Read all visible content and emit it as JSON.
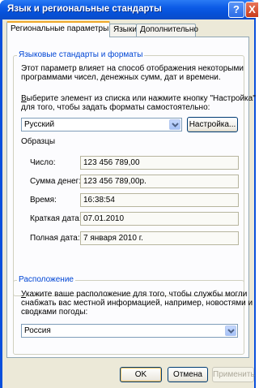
{
  "window": {
    "title": "Язык и региональные стандарты",
    "help_glyph": "?",
    "close_glyph": "X"
  },
  "tabs": [
    {
      "label": "Региональные параметры",
      "active": true
    },
    {
      "label": "Языки",
      "active": false
    },
    {
      "label": "Дополнительно",
      "active": false
    }
  ],
  "standards": {
    "group_title": "Языковые стандарты и форматы",
    "desc_line1": "Этот параметр влияет на способ отображения некоторыми",
    "desc_line2": "программами чисел, денежных сумм, дат и времени.",
    "choose_line1": "Выберите элемент из списка или нажмите кнопку \"Настройка\"",
    "choose_line2": "для того, чтобы задать форматы самостоятельно:",
    "selected_locale": "Русский",
    "customize_label": "Настройка...",
    "samples_title": "Образцы",
    "samples": [
      {
        "label": "Число:",
        "value": "123 456 789,00"
      },
      {
        "label": "Сумма денег:",
        "value": "123 456 789,00р."
      },
      {
        "label": "Время:",
        "value": "16:38:54"
      },
      {
        "label": "Краткая дата:",
        "value": "07.01.2010"
      },
      {
        "label": "Полная дата:",
        "value": "7 января 2010 г."
      }
    ]
  },
  "location": {
    "group_title": "Расположение",
    "desc_line1": "Укажите ваше расположение для того, чтобы службы могли",
    "desc_line2": "снабжать вас местной информацией, например, новостями и",
    "desc_line3": "сводками погоды:",
    "selected_country": "Россия"
  },
  "footer": {
    "ok_label": "OK",
    "cancel_label": "Отмена",
    "apply_label": "Применить"
  }
}
